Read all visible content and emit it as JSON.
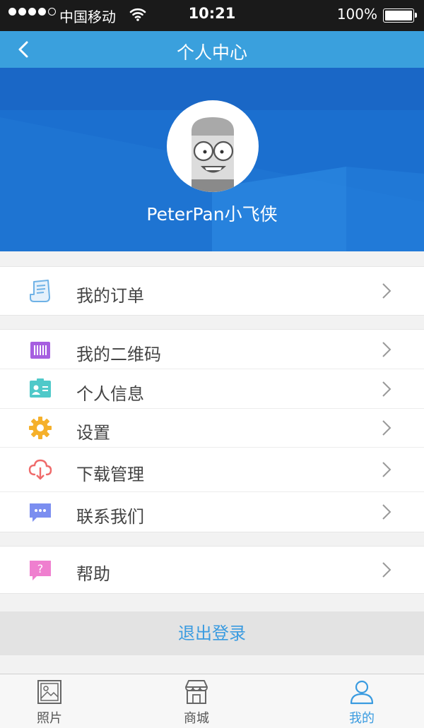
{
  "status_bar": {
    "carrier": "中国移动",
    "time": "10:21",
    "battery": "100%",
    "signal_bars": 4
  },
  "nav": {
    "title": "个人中心",
    "back_icon": "chevron-left-icon"
  },
  "profile": {
    "username": "PeterPan小飞侠",
    "avatar_icon": "cartoon-avatar-icon"
  },
  "menu_groups": [
    {
      "items": [
        {
          "label": "我的订单",
          "icon": "order-receipt-icon",
          "color": "#6fb2e6"
        }
      ]
    },
    {
      "items": [
        {
          "label": "我的二维码",
          "icon": "qr-code-icon",
          "color": "#a65ee0"
        },
        {
          "label": "个人信息",
          "icon": "id-card-icon",
          "color": "#4fc9c9"
        },
        {
          "label": "设置",
          "icon": "gear-icon",
          "color": "#f5b02a"
        },
        {
          "label": "下载管理",
          "icon": "cloud-download-icon",
          "color": "#ef6a6a"
        },
        {
          "label": "联系我们",
          "icon": "chat-bubble-icon",
          "color": "#7b8ef0"
        }
      ]
    },
    {
      "items": [
        {
          "label": "帮助",
          "icon": "help-bubble-icon",
          "color": "#ef7fcf"
        }
      ]
    }
  ],
  "logout_label": "退出登录",
  "tabs": [
    {
      "label": "照片",
      "icon": "photo-icon",
      "active": false
    },
    {
      "label": "商城",
      "icon": "store-icon",
      "active": false
    },
    {
      "label": "我的",
      "icon": "person-icon",
      "active": true
    }
  ],
  "colors": {
    "nav_bg": "#3aa0dd",
    "banner_bg": "#1b6fcf",
    "accent": "#3a9be0"
  }
}
